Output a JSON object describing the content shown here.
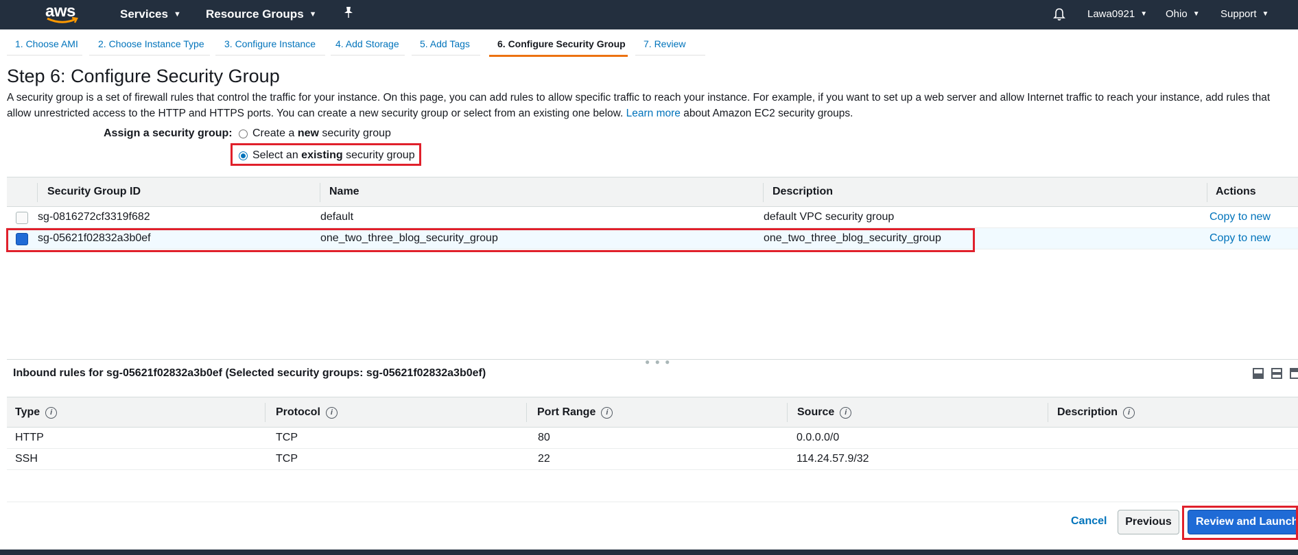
{
  "topnav": {
    "logo_text": "aws",
    "services": "Services",
    "resource_groups": "Resource Groups",
    "user": "Lawa0921",
    "region": "Ohio",
    "support": "Support"
  },
  "steps": [
    {
      "label": "1. Choose AMI"
    },
    {
      "label": "2. Choose Instance Type"
    },
    {
      "label": "3. Configure Instance"
    },
    {
      "label": "4. Add Storage"
    },
    {
      "label": "5. Add Tags"
    },
    {
      "label": "6. Configure Security Group"
    },
    {
      "label": "7. Review"
    }
  ],
  "page": {
    "title": "Step 6: Configure Security Group",
    "intro_text": "A security group is a set of firewall rules that control the traffic for your instance. On this page, you can add rules to allow specific traffic to reach your instance. For example, if you want to set up a web server and allow Internet traffic to reach your instance, add rules that allow unrestricted access to the HTTP and HTTPS ports. You can create a new security group or select from an existing one below.",
    "learn_more": "Learn more",
    "intro_suffix": "about Amazon EC2 security groups."
  },
  "assign": {
    "label": "Assign a security group:",
    "option_new_pre": "Create a",
    "option_new_bold": "new",
    "option_new_post": "security group",
    "option_existing_pre": "Select an",
    "option_existing_bold": "existing",
    "option_existing_post": "security group",
    "selected": "existing"
  },
  "sg_table": {
    "headers": {
      "id": "Security Group ID",
      "name": "Name",
      "description": "Description",
      "actions": "Actions"
    },
    "rows": [
      {
        "id": "sg-0816272cf3319f682",
        "name": "default",
        "description": "default VPC security group",
        "action": "Copy to new",
        "selected": false
      },
      {
        "id": "sg-05621f02832a3b0ef",
        "name": "one_two_three_blog_security_group",
        "description": "one_two_three_blog_security_group",
        "action": "Copy to new",
        "selected": true
      }
    ]
  },
  "inbound": {
    "title": "Inbound rules for sg-05621f02832a3b0ef (Selected security groups: sg-05621f02832a3b0ef)",
    "headers": {
      "type": "Type",
      "protocol": "Protocol",
      "port_range": "Port Range",
      "source": "Source",
      "description": "Description"
    },
    "rows": [
      {
        "type": "HTTP",
        "protocol": "TCP",
        "port_range": "80",
        "source": "0.0.0.0/0",
        "description": ""
      },
      {
        "type": "SSH",
        "protocol": "TCP",
        "port_range": "22",
        "source": "114.24.57.9/32",
        "description": ""
      }
    ]
  },
  "footer": {
    "cancel": "Cancel",
    "previous": "Previous",
    "review_launch": "Review and Launch"
  },
  "colors": {
    "nav_bg": "#232f3e",
    "link": "#0073bb",
    "primary": "#1f6bd6",
    "active_tab": "#ec7211",
    "highlight": "#e0202b"
  }
}
